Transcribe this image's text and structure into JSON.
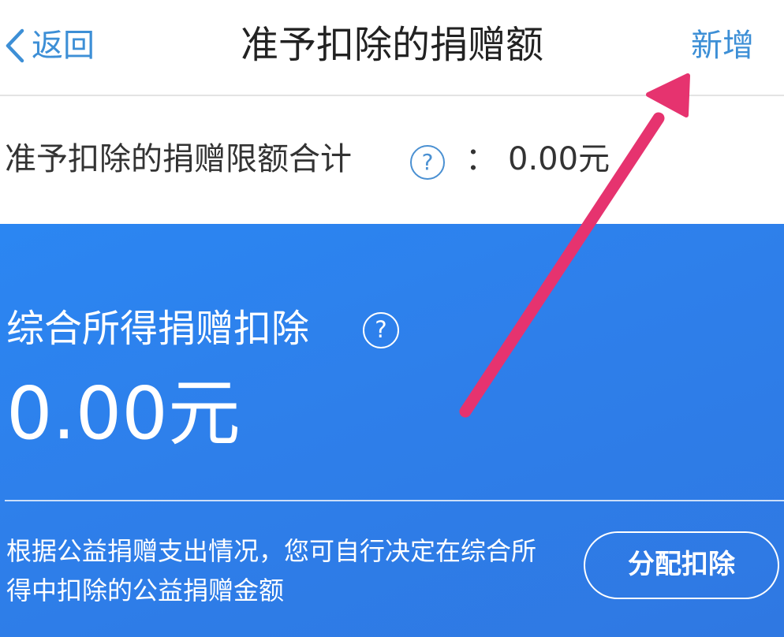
{
  "header": {
    "back_label": "返回",
    "title": "准予扣除的捐赠额",
    "add_label": "新增"
  },
  "limit": {
    "label": "准予扣除的捐赠限额合计",
    "help_glyph": "?",
    "colon": "：",
    "value": "0.00元"
  },
  "card": {
    "title": "综合所得捐赠扣除",
    "help_glyph": "?",
    "amount": "0.00元",
    "description": "根据公益捐赠支出情况，您可自行决定在综合所得中扣除的公益捐赠金额",
    "allocate_button": "分配扣除"
  },
  "icons": {
    "back": "chevron-left-icon",
    "help": "question-circle-icon"
  },
  "colors": {
    "link": "#3d8fd6",
    "card_bg": "#2e7fea",
    "annotation_arrow": "#e6336f"
  }
}
